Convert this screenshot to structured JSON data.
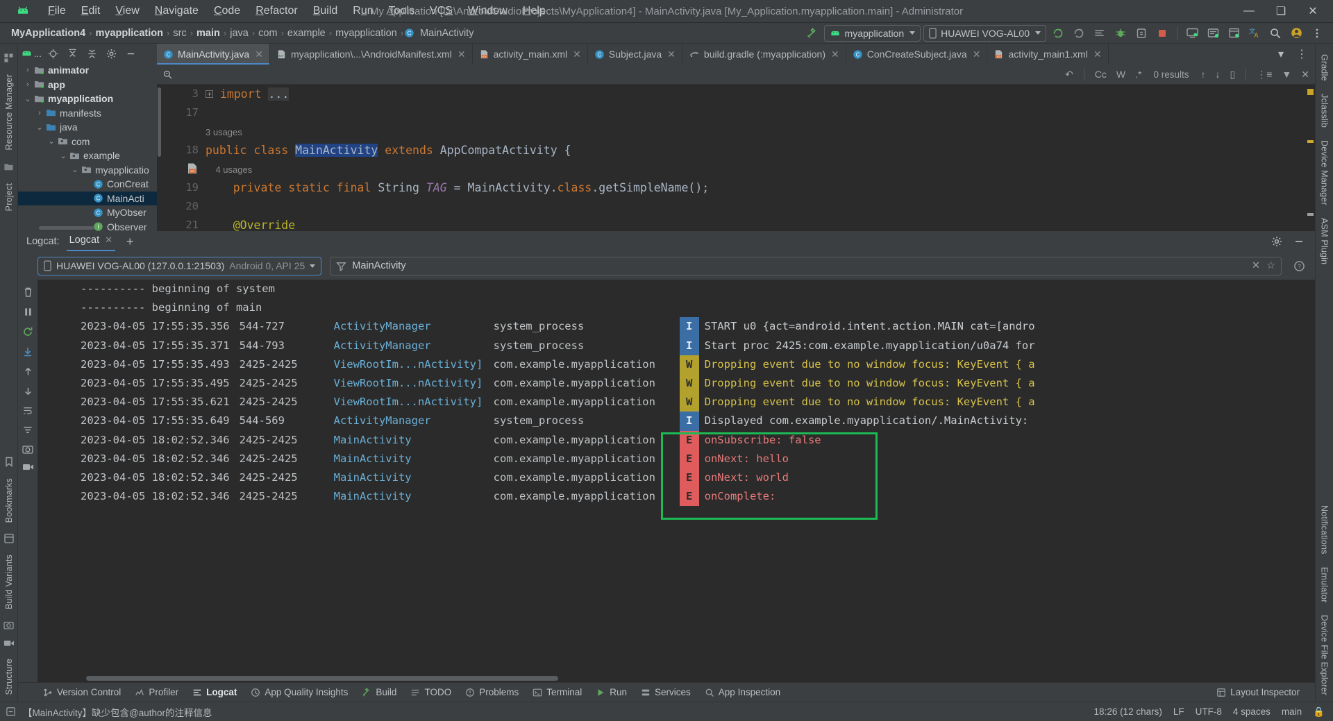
{
  "window": {
    "title": "My Application [D:\\AndroidStudioProjects\\MyApplication4] - MainActivity.java [My_Application.myapplication.main] - Administrator",
    "minimize": "—",
    "maximize": "❑",
    "close": "✕"
  },
  "menubar": {
    "items": [
      {
        "label": "File"
      },
      {
        "label": "Edit"
      },
      {
        "label": "View"
      },
      {
        "label": "Navigate"
      },
      {
        "label": "Code"
      },
      {
        "label": "Refactor"
      },
      {
        "label": "Build"
      },
      {
        "label": "Run"
      },
      {
        "label": "Tools"
      },
      {
        "label": "VCS"
      },
      {
        "label": "Window"
      },
      {
        "label": "Help"
      }
    ]
  },
  "breadcrumbs": {
    "items": [
      {
        "label": "MyApplication4",
        "bold": true
      },
      {
        "label": "myapplication",
        "bold": true
      },
      {
        "label": "src",
        "bold": false
      },
      {
        "label": "main",
        "bold": true
      },
      {
        "label": "java",
        "bold": false
      },
      {
        "label": "com",
        "bold": false
      },
      {
        "label": "example",
        "bold": false
      },
      {
        "label": "myapplication",
        "bold": false
      },
      {
        "label": "MainActivity",
        "bold": false,
        "icon": "class-icon"
      }
    ],
    "separator": "›"
  },
  "toolbar": {
    "module_selector": "myapplication",
    "device_selector": "HUAWEI VOG-AL00",
    "icons": [
      "run-icon",
      "debug-rerun-icon",
      "logcat-icon",
      "debug-icon",
      "run-inspections-icon",
      "avd-manager-icon",
      "sdk-manager-icon",
      "device-explorer-icon",
      "translate-icon",
      "search-icon",
      "account-icon",
      "more-icon"
    ]
  },
  "left_rail": {
    "items": [
      {
        "label": "Resource Manager"
      },
      {
        "label": "Project"
      }
    ]
  },
  "right_rail": {
    "items": [
      {
        "label": "Gradle"
      },
      {
        "label": "Jclasslib"
      },
      {
        "label": "Device Manager"
      },
      {
        "label": "ASM Plugin"
      },
      {
        "label": "Notifications"
      },
      {
        "label": "Emulator"
      },
      {
        "label": "Device File Explorer"
      }
    ]
  },
  "left_bottom_rail": {
    "items": [
      {
        "label": "Bookmarks"
      },
      {
        "label": "Build Variants"
      },
      {
        "label": "Structure"
      }
    ]
  },
  "project_panel": {
    "title": "...",
    "toolbar_icons": [
      "android-view-icon",
      "locate-icon",
      "expand-all-icon",
      "collapse-all-icon",
      "settings-gear-icon",
      "hide-icon"
    ],
    "tree": [
      {
        "indent": 0,
        "arrow": "›",
        "icon": "module-folder-icon",
        "label": "animator",
        "bold": true,
        "selected": false
      },
      {
        "indent": 0,
        "arrow": "›",
        "icon": "module-folder-icon",
        "label": "app",
        "bold": true,
        "selected": false
      },
      {
        "indent": 0,
        "arrow": "⌄",
        "icon": "module-folder-icon",
        "label": "myapplication",
        "bold": true,
        "selected": false
      },
      {
        "indent": 1,
        "arrow": "›",
        "icon": "folder-icon",
        "label": "manifests",
        "bold": false,
        "selected": false
      },
      {
        "indent": 1,
        "arrow": "⌄",
        "icon": "folder-icon",
        "label": "java",
        "bold": false,
        "selected": false
      },
      {
        "indent": 2,
        "arrow": "⌄",
        "icon": "package-icon",
        "label": "com",
        "bold": false,
        "selected": false
      },
      {
        "indent": 3,
        "arrow": "⌄",
        "icon": "package-icon",
        "label": "example",
        "bold": false,
        "selected": false
      },
      {
        "indent": 4,
        "arrow": "⌄",
        "icon": "package-icon",
        "label": "myapplicatio",
        "bold": false,
        "selected": false
      },
      {
        "indent": 5,
        "arrow": "",
        "icon": "class-icon",
        "label": "ConCreat",
        "bold": false,
        "selected": false
      },
      {
        "indent": 5,
        "arrow": "",
        "icon": "class-icon",
        "label": "MainActi",
        "bold": false,
        "selected": true
      },
      {
        "indent": 5,
        "arrow": "",
        "icon": "class-icon",
        "label": "MyObser",
        "bold": false,
        "selected": false
      },
      {
        "indent": 5,
        "arrow": "",
        "icon": "interface-icon",
        "label": "Observer",
        "bold": false,
        "selected": false
      }
    ]
  },
  "editor": {
    "tabs": [
      {
        "label": "MainActivity.java",
        "icon": "java-class-icon",
        "active": true,
        "closable": true
      },
      {
        "label": "myapplication\\...\\AndroidManifest.xml",
        "icon": "manifest-icon",
        "active": false,
        "closable": true
      },
      {
        "label": "activity_main.xml",
        "icon": "layout-xml-icon",
        "active": false,
        "closable": true
      },
      {
        "label": "Subject.java",
        "icon": "java-class-icon",
        "active": false,
        "closable": true
      },
      {
        "label": "build.gradle (:myapplication)",
        "icon": "gradle-icon",
        "active": false,
        "closable": true
      },
      {
        "label": "ConCreateSubject.java",
        "icon": "java-class-icon",
        "active": false,
        "closable": true
      },
      {
        "label": "activity_main1.xml",
        "icon": "layout-xml-icon",
        "active": false,
        "closable": true
      }
    ],
    "find": {
      "placeholder": "",
      "value": "",
      "match_case": "Cc",
      "words": "W",
      "regex": ".*",
      "results": "0 results"
    },
    "lines": [
      {
        "num": "3",
        "fold": "+",
        "tokens": [
          {
            "t": "import ",
            "c": "kw"
          },
          {
            "t": "...",
            "c": "dots"
          }
        ]
      },
      {
        "num": "17",
        "fold": "",
        "tokens": []
      },
      {
        "num": "",
        "fold": "",
        "usage": "3 usages",
        "tokens": []
      },
      {
        "num": "18",
        "fold": "",
        "gutter_icon": "java-class-marker",
        "tokens": [
          {
            "t": "public class ",
            "c": "kw"
          },
          {
            "t": "MainActivity",
            "c": "hl-sel"
          },
          {
            "t": " extends ",
            "c": "kw"
          },
          {
            "t": "AppCompatActivity {",
            "c": "cls"
          }
        ]
      },
      {
        "num": "",
        "fold": "",
        "usage": "    4 usages",
        "tokens": []
      },
      {
        "num": "19",
        "fold": "",
        "tokens": [
          {
            "t": "    private static final ",
            "c": "kw"
          },
          {
            "t": "String ",
            "c": "cls"
          },
          {
            "t": "TAG",
            "c": "fld"
          },
          {
            "t": " = MainActivity.",
            "c": "cls"
          },
          {
            "t": "class",
            "c": "kw"
          },
          {
            "t": ".getSimpleName();",
            "c": "cls"
          }
        ]
      },
      {
        "num": "20",
        "fold": "",
        "tokens": []
      },
      {
        "num": "21",
        "fold": "",
        "tokens": [
          {
            "t": "    @Override",
            "c": "ann"
          }
        ]
      }
    ]
  },
  "logcat": {
    "panel_label": "Logcat:",
    "tab_label": "Logcat",
    "add_tab": "+",
    "device": {
      "name": "HUAWEI VOG-AL00 (127.0.0.1:21503)",
      "detail": "Android 0, API 25",
      "icon": "phone-icon"
    },
    "filter": {
      "value": "MainActivity",
      "icon": "filter-icon",
      "clear": "✕",
      "favorite": "☆",
      "help": "?"
    },
    "rail_icons": [
      "clear-logcat-icon",
      "pause-icon",
      "restart-icon",
      "scroll-to-end-icon",
      "up-icon",
      "down-icon",
      "soft-wrap-icon",
      "filter-settings-icon",
      "screenshot-icon",
      "record-icon"
    ],
    "rows": [
      {
        "plain": "---------- beginning of system"
      },
      {
        "plain": "---------- beginning of main"
      },
      {
        "ts": "2023-04-05 17:55:35.356",
        "pid": "544-727",
        "tag": "ActivityManager",
        "pkg": "system_process",
        "level": "I",
        "msg": "START u0 {act=android.intent.action.MAIN cat=[andro"
      },
      {
        "ts": "2023-04-05 17:55:35.371",
        "pid": "544-793",
        "tag": "ActivityManager",
        "pkg": "system_process",
        "level": "I",
        "msg": "Start proc 2425:com.example.myapplication/u0a74 for"
      },
      {
        "ts": "2023-04-05 17:55:35.493",
        "pid": "2425-2425",
        "tag": "ViewRootIm...nActivity]",
        "pkg": "com.example.myapplication",
        "level": "W",
        "msg": "Dropping event due to no window focus: KeyEvent { a"
      },
      {
        "ts": "2023-04-05 17:55:35.495",
        "pid": "2425-2425",
        "tag": "ViewRootIm...nActivity]",
        "pkg": "com.example.myapplication",
        "level": "W",
        "msg": "Dropping event due to no window focus: KeyEvent { a"
      },
      {
        "ts": "2023-04-05 17:55:35.621",
        "pid": "2425-2425",
        "tag": "ViewRootIm...nActivity]",
        "pkg": "com.example.myapplication",
        "level": "W",
        "msg": "Dropping event due to no window focus: KeyEvent { a"
      },
      {
        "ts": "2023-04-05 17:55:35.649",
        "pid": "544-569",
        "tag": "ActivityManager",
        "pkg": "system_process",
        "level": "I",
        "msg": "Displayed com.example.myapplication/.MainActivity:"
      },
      {
        "ts": "2023-04-05 18:02:52.346",
        "pid": "2425-2425",
        "tag": "MainActivity",
        "pkg": "com.example.myapplication",
        "level": "E",
        "msg": "onSubscribe: false"
      },
      {
        "ts": "2023-04-05 18:02:52.346",
        "pid": "2425-2425",
        "tag": "MainActivity",
        "pkg": "com.example.myapplication",
        "level": "E",
        "msg": "onNext: hello"
      },
      {
        "ts": "2023-04-05 18:02:52.346",
        "pid": "2425-2425",
        "tag": "MainActivity",
        "pkg": "com.example.myapplication",
        "level": "E",
        "msg": "onNext: world"
      },
      {
        "ts": "2023-04-05 18:02:52.346",
        "pid": "2425-2425",
        "tag": "MainActivity",
        "pkg": "com.example.myapplication",
        "level": "E",
        "msg": "onComplete:"
      }
    ],
    "highlight_color": "#1db954"
  },
  "bottom_bar": {
    "items": [
      {
        "label": "Version Control",
        "icon": "vcs-icon",
        "active": false
      },
      {
        "label": "Profiler",
        "icon": "profiler-icon",
        "active": false
      },
      {
        "label": "Logcat",
        "icon": "logcat-icon",
        "active": true
      },
      {
        "label": "App Quality Insights",
        "icon": "insights-icon",
        "active": false
      },
      {
        "label": "Build",
        "icon": "build-icon",
        "active": false
      },
      {
        "label": "TODO",
        "icon": "todo-icon",
        "active": false
      },
      {
        "label": "Problems",
        "icon": "problems-icon",
        "active": false
      },
      {
        "label": "Terminal",
        "icon": "terminal-icon",
        "active": false
      },
      {
        "label": "Run",
        "icon": "run-icon",
        "active": false
      },
      {
        "label": "Services",
        "icon": "services-icon",
        "active": false
      },
      {
        "label": "App Inspection",
        "icon": "app-inspection-icon",
        "active": false
      }
    ],
    "right_label": "Layout Inspector",
    "right_icon": "layout-inspector-icon"
  },
  "statusbar": {
    "inspection_message": "【MainActivity】缺少包含@author的注释信息",
    "caret": "18:26 (12 chars)",
    "line_sep": "LF",
    "encoding": "UTF-8",
    "indent": "4 spaces",
    "branch": "main",
    "lock": "🔒"
  }
}
